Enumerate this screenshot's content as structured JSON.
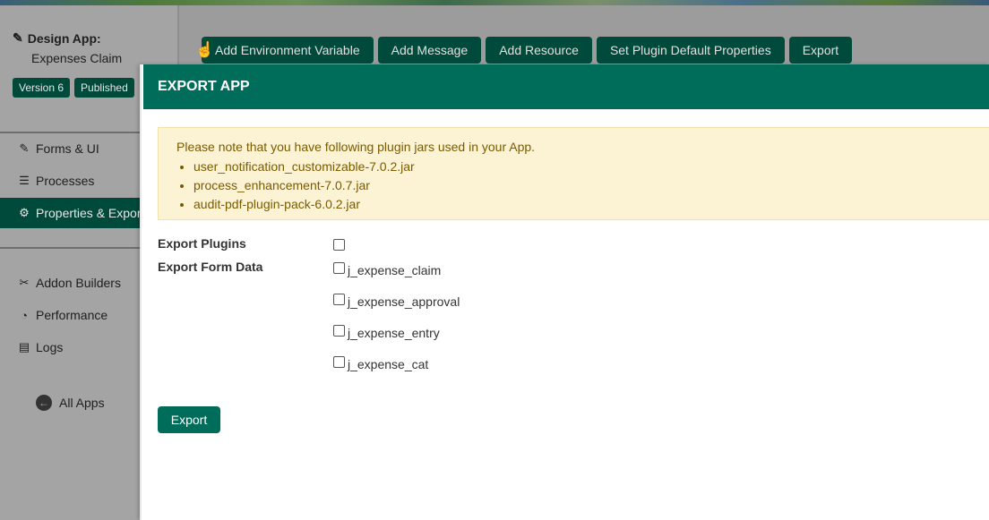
{
  "sidebar": {
    "design_label": "Design App:",
    "app_name": "Expenses Claim",
    "version_badge": "Version 6",
    "status_badge": "Published",
    "nav": [
      {
        "label": "Forms & UI",
        "icon": "edit-icon"
      },
      {
        "label": "Processes",
        "icon": "list-icon"
      },
      {
        "label": "Properties & Export",
        "icon": "gear-icon"
      }
    ],
    "tools": [
      {
        "label": "Addon Builders",
        "icon": "tools-icon"
      },
      {
        "label": "Performance",
        "icon": "dashboard-icon"
      },
      {
        "label": "Logs",
        "icon": "scroll-icon"
      }
    ],
    "all_apps": "All Apps"
  },
  "toolbar": {
    "buttons": [
      "Add Environment Variable",
      "Add Message",
      "Add Resource",
      "Set Plugin Default Properties",
      "Export"
    ]
  },
  "dialog": {
    "title": "EXPORT APP",
    "notice": {
      "text": "Please note that you have following plugin jars used in your App.",
      "items": [
        "user_notification_customizable-7.0.2.jar",
        "process_enhancement-7.0.7.jar",
        "audit-pdf-plugin-pack-6.0.2.jar"
      ]
    },
    "export_plugins_label": "Export Plugins",
    "export_form_data_label": "Export Form Data",
    "form_data_options": [
      "j_expense_claim",
      "j_expense_approval",
      "j_expense_entry",
      "j_expense_cat"
    ],
    "export_button": "Export"
  },
  "colors": {
    "accent": "#006c5a",
    "dark_accent": "#004a3c",
    "warning_bg": "#fcf3d4",
    "warning_text": "#7a5b00"
  }
}
